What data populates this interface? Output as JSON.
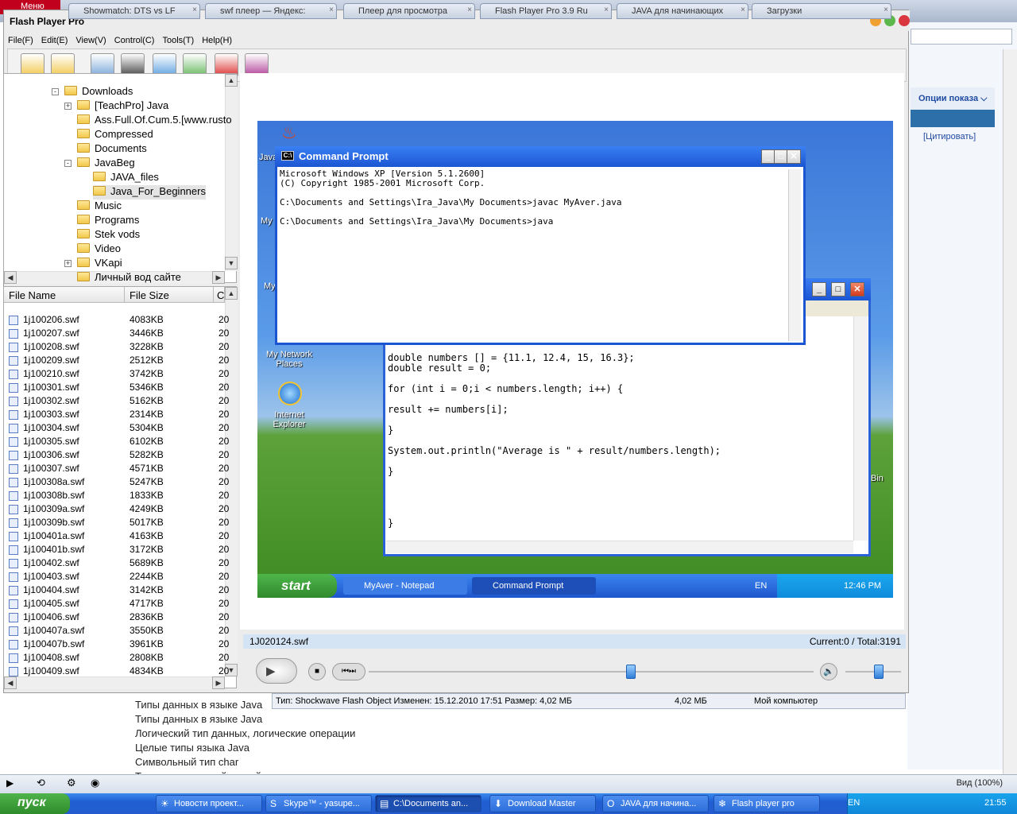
{
  "opera": {
    "menu_label": "Меню",
    "tabs": [
      "Showmatch: DTS vs LF",
      "swf плеер — Яндекс:",
      "Плеер для просмотра",
      "Flash Player Pro 3.9 Ru",
      "JAVA для начинающих",
      "Загрузки"
    ],
    "options_label": "Опции показа",
    "cite_label": "[Цитировать]",
    "zoom_label": "Вид (100%)"
  },
  "background_list": [
    "Типы данных в языке Java",
    "Типы данных в языке Java",
    "Логический тип данных, логические операции",
    "Целые типы языка Java",
    "Символьный тип char",
    "Типы с плавающей точкой"
  ],
  "flashplayer": {
    "title": "Flash Player Pro",
    "menu": [
      "File(F)",
      "Edit(E)",
      "View(V)",
      "Control(C)",
      "Tools(T)",
      "Help(H)"
    ],
    "tools": [
      "open-file-icon",
      "open-folder-icon",
      "playlist-icon",
      "camera-icon",
      "fullscreen-icon",
      "monitor-icon",
      "favorites-icon",
      "help-book-icon"
    ],
    "tree": [
      {
        "label": "Downloads",
        "level": 0,
        "toggle": "-"
      },
      {
        "label": "[TeachPro] Java",
        "level": 1,
        "toggle": "+"
      },
      {
        "label": "Ass.Full.Of.Cum.5.[www.rusto",
        "level": 1,
        "toggle": ""
      },
      {
        "label": "Compressed",
        "level": 1,
        "toggle": ""
      },
      {
        "label": "Documents",
        "level": 1,
        "toggle": ""
      },
      {
        "label": "JavaBeg",
        "level": 1,
        "toggle": "-"
      },
      {
        "label": "JAVA_files",
        "level": 2,
        "toggle": ""
      },
      {
        "label": "Java_For_Beginners",
        "level": 2,
        "toggle": ""
      },
      {
        "label": "Music",
        "level": 1,
        "toggle": ""
      },
      {
        "label": "Programs",
        "level": 1,
        "toggle": ""
      },
      {
        "label": "Stek vods",
        "level": 1,
        "toggle": ""
      },
      {
        "label": "Video",
        "level": 1,
        "toggle": ""
      },
      {
        "label": "VKapi",
        "level": 1,
        "toggle": "+"
      },
      {
        "label": "Личный вод сайте",
        "level": 1,
        "toggle": ""
      }
    ],
    "file_headers": {
      "name": "File Name",
      "size": "File Size",
      "date": "C"
    },
    "files": [
      {
        "name": "1j100206.swf",
        "size": "4083KB",
        "date": "20"
      },
      {
        "name": "1j100207.swf",
        "size": "3446KB",
        "date": "20"
      },
      {
        "name": "1j100208.swf",
        "size": "3228KB",
        "date": "20"
      },
      {
        "name": "1j100209.swf",
        "size": "2512KB",
        "date": "20"
      },
      {
        "name": "1j100210.swf",
        "size": "3742KB",
        "date": "20"
      },
      {
        "name": "1j100301.swf",
        "size": "5346KB",
        "date": "20"
      },
      {
        "name": "1j100302.swf",
        "size": "5162KB",
        "date": "20"
      },
      {
        "name": "1j100303.swf",
        "size": "2314KB",
        "date": "20"
      },
      {
        "name": "1j100304.swf",
        "size": "5304KB",
        "date": "20"
      },
      {
        "name": "1j100305.swf",
        "size": "6102KB",
        "date": "20"
      },
      {
        "name": "1j100306.swf",
        "size": "5282KB",
        "date": "20"
      },
      {
        "name": "1j100307.swf",
        "size": "4571KB",
        "date": "20"
      },
      {
        "name": "1j100308a.swf",
        "size": "5247KB",
        "date": "20"
      },
      {
        "name": "1j100308b.swf",
        "size": "1833KB",
        "date": "20"
      },
      {
        "name": "1j100309a.swf",
        "size": "4249KB",
        "date": "20"
      },
      {
        "name": "1j100309b.swf",
        "size": "5017KB",
        "date": "20"
      },
      {
        "name": "1j100401a.swf",
        "size": "4163KB",
        "date": "20"
      },
      {
        "name": "1j100401b.swf",
        "size": "3172KB",
        "date": "20"
      },
      {
        "name": "1j100402.swf",
        "size": "5689KB",
        "date": "20"
      },
      {
        "name": "1j100403.swf",
        "size": "2244KB",
        "date": "20"
      },
      {
        "name": "1j100404.swf",
        "size": "3142KB",
        "date": "20"
      },
      {
        "name": "1j100405.swf",
        "size": "4717KB",
        "date": "20"
      },
      {
        "name": "1j100406.swf",
        "size": "2836KB",
        "date": "20"
      },
      {
        "name": "1j100407a.swf",
        "size": "3550KB",
        "date": "20"
      },
      {
        "name": "1j100407b.swf",
        "size": "3961KB",
        "date": "20"
      },
      {
        "name": "1j100408.swf",
        "size": "2808KB",
        "date": "20"
      },
      {
        "name": "1j100409.swf",
        "size": "4834KB",
        "date": "20"
      }
    ],
    "current_file": "1J020124.swf",
    "counter": "Current:0 / Total:3191",
    "seek_fraction": 0.59,
    "volume_fraction": 0.6
  },
  "swf_content": {
    "desktop_labels": [
      "My Network\nPlaces",
      "Internet\nExplorer",
      "Java",
      "My",
      "My",
      "Bin"
    ],
    "cmd": {
      "title": "Command Prompt",
      "lines": [
        "Microsoft Windows XP [Version 5.1.2600]",
        "(C) Copyright 1985-2001 Microsoft Corp.",
        "",
        "C:\\Documents and Settings\\Ira_Java\\My Documents>javac MyAver.java",
        "",
        "C:\\Documents and Settings\\Ira_Java\\My Documents>java"
      ]
    },
    "notepad_code": "public static void main (String[] args){\n\ndouble numbers [] = {11.1, 12.4, 15, 16.3};\ndouble result = 0;\n\nfor (int i = 0;i < numbers.length; i++) {\n\nresult += numbers[i];\n\n}\n\nSystem.out.println(\"Average is \" + result/numbers.length);\n\n}\n\n\n\n\n}",
    "taskbar": {
      "start": "start",
      "buttons": [
        "MyAver - Notepad",
        "Command Prompt"
      ],
      "lang": "EN",
      "clock": "12:46 PM"
    }
  },
  "explorer_status": {
    "info": "Тип: Shockwave Flash Object Изменен: 15.12.2010 17:51 Размер: 4,02 МБ",
    "size": "4,02 МБ",
    "location": "Мой компьютер"
  },
  "taskbar": {
    "start": "пуск",
    "buttons": [
      "Новости проект...",
      "Skype™ - yasupe...",
      "C:\\Documents an...",
      "Download Master",
      "JAVA для начина...",
      "Flash player pro"
    ],
    "lang": "EN",
    "clock": "21:55"
  },
  "colors": {
    "accent": "#1c55d2",
    "xp_green": "#2f8a2b",
    "opera_red": "#c0001c"
  }
}
